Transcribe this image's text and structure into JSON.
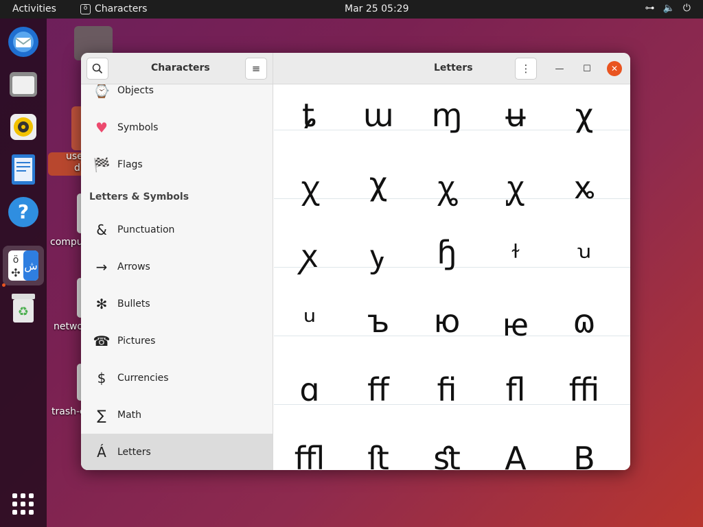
{
  "topbar": {
    "activities": "Activities",
    "app_name": "Characters",
    "clock": "Mar 25  05:29"
  },
  "desktop": {
    "labels": [
      "use",
      "d",
      "compu",
      "netwo",
      "trash-c"
    ]
  },
  "window": {
    "sidebar_title": "Characters",
    "content_title": "Letters"
  },
  "sidebar": {
    "items_top": [
      {
        "icon": "⌚",
        "label": "Objects"
      },
      {
        "icon": "♥",
        "label": "Symbols"
      },
      {
        "icon": "🏁",
        "label": "Flags"
      }
    ],
    "section": "Letters & Symbols",
    "items": [
      {
        "icon": "&",
        "label": "Punctuation"
      },
      {
        "icon": "→",
        "label": "Arrows"
      },
      {
        "icon": "✻",
        "label": "Bullets"
      },
      {
        "icon": "☎",
        "label": "Pictures"
      },
      {
        "icon": "$",
        "label": "Currencies"
      },
      {
        "icon": "∑",
        "label": "Math"
      },
      {
        "icon": "Á",
        "label": "Letters"
      }
    ]
  },
  "characters": [
    [
      "ȶ",
      "ɯ",
      "ɱ",
      "ʉ",
      "χ"
    ],
    [
      "ꭓ",
      "χ",
      "ꭔ",
      "ꭕ",
      "ꭖ"
    ],
    [
      "ꭗ",
      "ꭚ",
      "ɧ",
      "ꭞ",
      "ꭟ"
    ],
    [
      "ᵘ",
      "ъ",
      "ю",
      "ꭡ",
      "ɷ"
    ],
    [
      "ɑ",
      "ﬀ",
      "ﬁ",
      "ﬂ",
      "ﬃ"
    ],
    [
      "ﬄ",
      "ﬅ",
      "ﬆ",
      "A",
      "B"
    ]
  ]
}
